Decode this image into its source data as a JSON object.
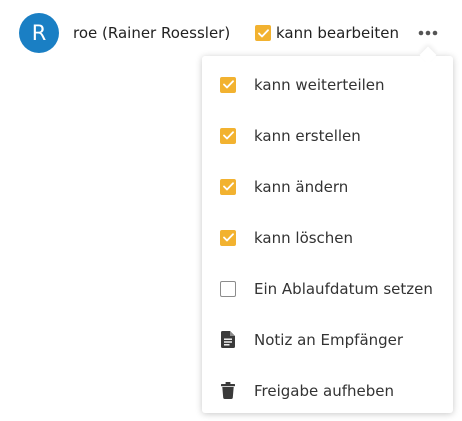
{
  "colors": {
    "avatar_bg": "#1a7fc4",
    "checkbox_checked": "#f2b230",
    "checkbox_unchecked_border": "#8c8c8c",
    "icon_dark": "#3a3a3a"
  },
  "share": {
    "avatar_letter": "R",
    "user_label": "roe (Rainer Roessler)",
    "edit_checked": true,
    "edit_label": "kann bearbeiten",
    "more_icon": "more-horizontal-icon"
  },
  "menu": {
    "items": [
      {
        "type": "checkbox",
        "checked": true,
        "label": "kann weiterteilen"
      },
      {
        "type": "checkbox",
        "checked": true,
        "label": "kann erstellen"
      },
      {
        "type": "checkbox",
        "checked": true,
        "label": "kann ändern"
      },
      {
        "type": "checkbox",
        "checked": true,
        "label": "kann löschen"
      },
      {
        "type": "checkbox",
        "checked": false,
        "label": "Ein Ablaufdatum setzen"
      },
      {
        "type": "action",
        "icon": "note-icon",
        "label": "Notiz an Empfänger"
      },
      {
        "type": "action",
        "icon": "trash-icon",
        "label": "Freigabe aufheben"
      }
    ]
  }
}
